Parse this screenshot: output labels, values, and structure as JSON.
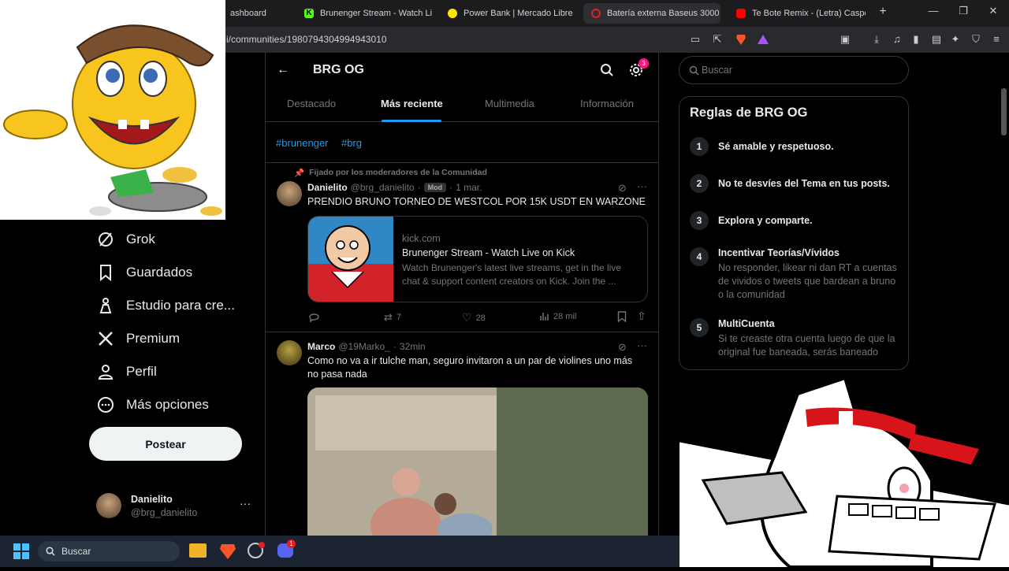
{
  "browser": {
    "tabs": [
      {
        "label": "ashboard",
        "color": "#1d9bf0"
      },
      {
        "label": "Brunenger Stream - Watch Live c",
        "color": "#53fc18"
      },
      {
        "label": "Power Bank | Mercado Libre",
        "color": "#ffe600"
      },
      {
        "label": "Batería externa Baseus 3000",
        "color": "#e02020"
      },
      {
        "label": "Te Bote Remix - (Letra) Casper, N",
        "color": "#ff0000"
      }
    ],
    "new_tab": "+",
    "url": "i/communities/1980794304994943010",
    "brave_badge": ""
  },
  "nav": {
    "items": [
      {
        "label": "Grok",
        "icon": "grok-icon"
      },
      {
        "label": "Guardados",
        "icon": "bookmark-icon"
      },
      {
        "label": "Estudio para cre...",
        "icon": "studio-icon"
      },
      {
        "label": "Premium",
        "icon": "x-logo-icon"
      },
      {
        "label": "Perfil",
        "icon": "person-icon"
      },
      {
        "label": "Más opciones",
        "icon": "more-circle-icon"
      }
    ],
    "post_button": "Postear",
    "account": {
      "name": "Danielito",
      "handle": "@brg_danielito",
      "more": "···"
    }
  },
  "community": {
    "title": "BRG OG",
    "settings_badge": "3",
    "tabs": [
      "Destacado",
      "Más reciente",
      "Multimedia",
      "Información"
    ],
    "active_tab": 1,
    "hashtags": [
      "#brunenger",
      "#brg"
    ]
  },
  "posts": [
    {
      "pinned_label": "Fijado por los moderadores de la Comunidad",
      "name": "Danielito",
      "handle": "@brg_danielito",
      "dot": "·",
      "badge": "Mod",
      "time": "1 mar.",
      "text": "PRENDIO BRUNO TORNEO DE WESTCOL POR 15K USDT EN WARZONE",
      "card": {
        "domain": "kick.com",
        "title": "Brunenger Stream - Watch Live on Kick",
        "desc": "Watch Brunenger's latest live streams, get in the live chat & support content creators on Kick. Join the ..."
      },
      "stats": {
        "replies": "",
        "reposts": "7",
        "likes": "28",
        "views": "28 mil"
      }
    },
    {
      "name": "Marco",
      "handle": "@19Marko_",
      "dot": "·",
      "time": "32min",
      "text": "Como no va a ir tulche man, seguro invitaron a un par de violines uno más no pasa nada"
    }
  ],
  "search": {
    "placeholder": "Buscar"
  },
  "rules": {
    "title": "Reglas de BRG OG",
    "items": [
      {
        "num": "1",
        "title": "Sé amable y respetuoso.",
        "desc": ""
      },
      {
        "num": "2",
        "title": "No te desvíes del Tema en tus posts.",
        "desc": ""
      },
      {
        "num": "3",
        "title": "Explora y comparte.",
        "desc": ""
      },
      {
        "num": "4",
        "title": "Incentivar Teorías/Vívidos",
        "desc": "No responder, likear ni dan RT a cuentas de vividos o tweets que bardean a bruno o la comunidad"
      },
      {
        "num": "5",
        "title": "MultiCuenta",
        "desc": "Si te creaste otra cuenta luego de que la original fue baneada, serás baneado"
      }
    ]
  },
  "taskbar": {
    "search_label": "Buscar",
    "discord_badge": "1"
  },
  "colors": {
    "accent": "#1d9bf0",
    "background": "#000000",
    "border": "#2f3336",
    "muted": "#71767b"
  }
}
